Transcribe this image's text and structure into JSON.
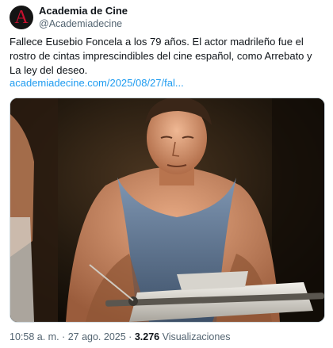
{
  "account": {
    "display_name": "Academia de Cine",
    "handle": "@Academiadecine",
    "avatar_letter": "A"
  },
  "tweet": {
    "text": "Fallece Eusebio Foncela a los 79 años. El actor madrileño fue el rostro de cintas imprescindibles del cine español, como Arrebato y La ley del deseo.",
    "link": "academiadecine.com/2025/08/27/fal..."
  },
  "meta": {
    "time": "10:58 a. m.",
    "separator": "·",
    "date": "27 ago. 2025",
    "views_count": "3.276",
    "views_label": "Visualizaciones"
  },
  "colors": {
    "link": "#1d9bf0",
    "secondary_text": "#536471",
    "avatar_bg": "#141414",
    "avatar_letter": "#c8102e"
  }
}
